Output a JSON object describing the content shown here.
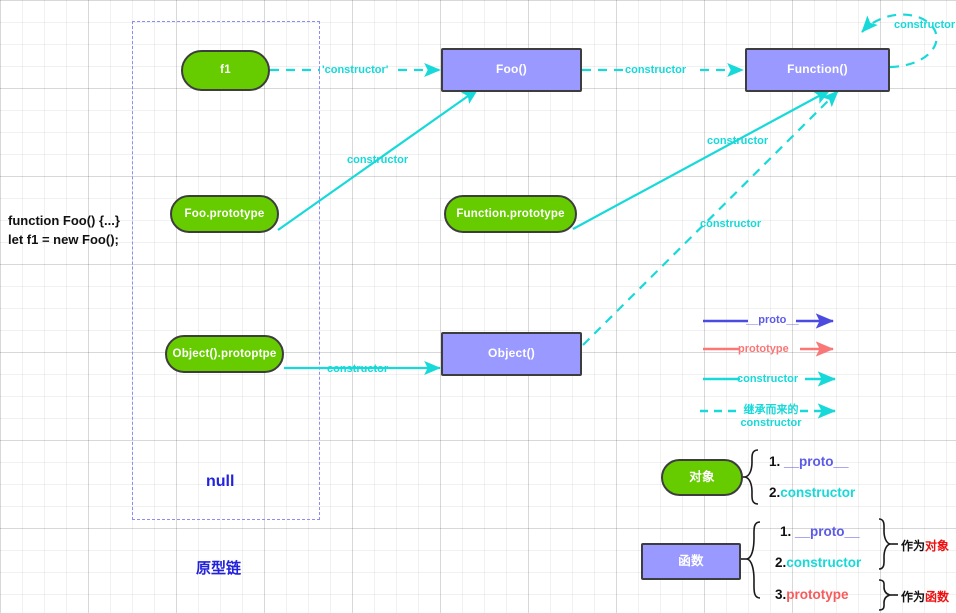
{
  "diagram": {
    "title_bottom": "原型链",
    "null_label": "null",
    "code_snippet": "function Foo() {...}\nlet f1 = new Foo();"
  },
  "colors": {
    "object_node": "#66CC00",
    "function_node": "#9999FF",
    "constructor_edge": "#17D9D9",
    "proto_edge": "#5B5BE8",
    "prototype_edge": "#F97777",
    "group_border": "#8c8cf5",
    "blue_text": "#2222DD",
    "red_accent": "#EE1111"
  },
  "nodes": [
    {
      "id": "f1",
      "label": "f1",
      "shape": "rounded",
      "kind": "object"
    },
    {
      "id": "foo",
      "label": "Foo()",
      "shape": "rect",
      "kind": "function"
    },
    {
      "id": "function",
      "label": "Function()",
      "shape": "rect",
      "kind": "function"
    },
    {
      "id": "foo_prototype",
      "label": "Foo.prototype",
      "shape": "rounded",
      "kind": "object"
    },
    {
      "id": "function_prototype",
      "label": "Function.prototype",
      "shape": "rounded",
      "kind": "object"
    },
    {
      "id": "object_prototype",
      "label": "Object().protoptpe",
      "shape": "rounded",
      "kind": "object"
    },
    {
      "id": "object",
      "label": "Object()",
      "shape": "rect",
      "kind": "function"
    }
  ],
  "edges": [
    {
      "from": "f1",
      "to": "foo",
      "label": "'constructor'",
      "style": "dashed"
    },
    {
      "from": "foo",
      "to": "function",
      "label": "constructor",
      "style": "dashed"
    },
    {
      "from": "function",
      "to": "function",
      "label": "constructor",
      "style": "dashed"
    },
    {
      "from": "foo_prototype",
      "to": "foo",
      "label": "constructor",
      "style": "solid"
    },
    {
      "from": "function_prototype",
      "to": "function",
      "label": "constructor",
      "style": "solid"
    },
    {
      "from": "object_prototype",
      "to": "object",
      "label": "constructor",
      "style": "solid"
    },
    {
      "from": "object",
      "to": "function",
      "label": "constructor",
      "style": "dashed"
    }
  ],
  "legend": {
    "items": [
      {
        "label": "__proto__",
        "color_key": "proto",
        "style": "solid"
      },
      {
        "label": "prototype",
        "color_key": "prototype",
        "style": "solid"
      },
      {
        "label": "constructor",
        "color_key": "constructor",
        "style": "solid"
      },
      {
        "label_line1": "继承而来的",
        "label_line2": "constructor",
        "color_key": "constructor",
        "style": "dashed"
      }
    ]
  },
  "attribute_legend": {
    "object": {
      "node_label": "对象",
      "items": [
        {
          "num": "1.",
          "name": "__proto__",
          "color_key": "proto"
        },
        {
          "num": "2.",
          "name": "constructor",
          "color_key": "constructor"
        }
      ]
    },
    "function": {
      "node_label": "函数",
      "items": [
        {
          "num": "1.",
          "name": "__proto__",
          "color_key": "proto"
        },
        {
          "num": "2.",
          "name": "constructor",
          "color_key": "constructor"
        },
        {
          "num": "3.",
          "name": "prototype",
          "color_key": "prototype"
        }
      ],
      "role_as_object_prefix": "作为",
      "role_as_object_word": "对象",
      "role_as_function_prefix": "作为",
      "role_as_function_word": "函数"
    }
  }
}
